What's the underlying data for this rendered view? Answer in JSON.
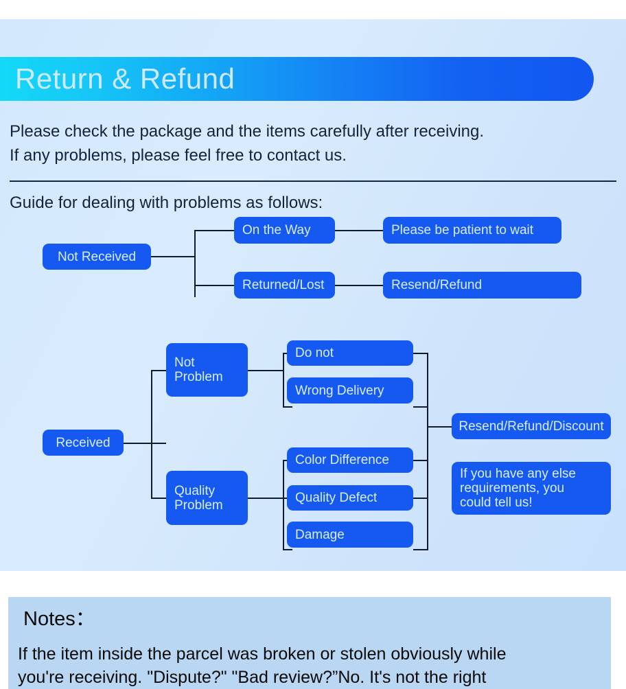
{
  "banner": {
    "title": "Return & Refund",
    "gradient_start": "#13d9f7",
    "gradient_end": "#1257f0",
    "title_color": "#cfe9fa"
  },
  "intro": {
    "line1": "Please check the package and the items carefully after receiving.",
    "line2": "If any problems, please feel free to contact us.",
    "guide": "Guide for dealing with problems as follows:"
  },
  "theme": {
    "page_background": "#ffffff",
    "panel_background": "#d6eafc",
    "node_fill": "#1659f0",
    "node_text": "#d6eefc",
    "wire_color": "#101b2e",
    "notes_background": "#b9d6f2",
    "body_text": "#12243c"
  },
  "flow_not_received": {
    "root": "Not Received",
    "branches": [
      {
        "stage": "On the Way",
        "outcome": "Please be patient to wait"
      },
      {
        "stage": "Returned/Lost",
        "outcome": "Resend/Refund"
      }
    ]
  },
  "flow_received": {
    "root": "Received",
    "categories": [
      {
        "label": "Not\nProblem",
        "items": [
          "Do not",
          "Wrong Delivery"
        ]
      },
      {
        "label": "Quality\nProblem",
        "items": [
          "Color Difference",
          "Quality Defect",
          "Damage"
        ]
      }
    ],
    "outcomes": [
      "Resend/Refund/Discount",
      "If you have any else\nrequirements, you\ncould tell us!"
    ]
  },
  "notes": {
    "title": "Notes：",
    "line1": "If the item inside the parcel was broken or stolen obviously while",
    "line2": "you're receiving. \"Dispute?\" \"Bad review?”No. It's not the right"
  }
}
